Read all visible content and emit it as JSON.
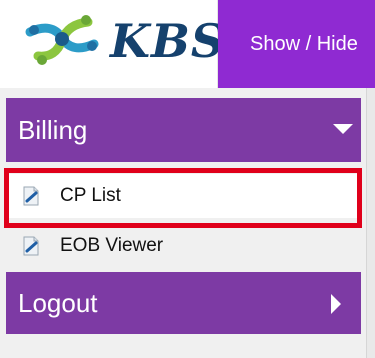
{
  "header": {
    "logo_text": "KBS",
    "show_hide_label": "Show / Hide"
  },
  "sidebar": {
    "sections": [
      {
        "label": "Billing",
        "icon": "chevron-down-icon",
        "expanded": true
      },
      {
        "label": "Logout",
        "icon": "chevron-right-icon",
        "expanded": false
      }
    ],
    "billing_items": [
      {
        "label": "CP List",
        "icon": "document-icon",
        "highlighted": true
      },
      {
        "label": "EOB Viewer",
        "icon": "document-icon",
        "highlighted": false
      }
    ]
  },
  "colors": {
    "menu_header": "#7d3aa4",
    "topbar_accent": "#8f2ad2",
    "highlight_border": "#e0001b",
    "logo_text": "#15416d"
  }
}
